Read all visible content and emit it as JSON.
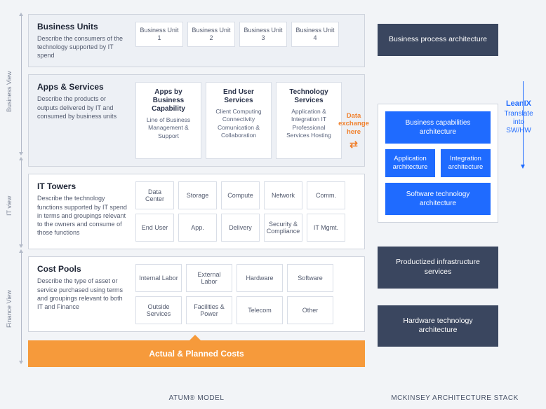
{
  "sideLabels": {
    "business": "Business View",
    "it": "IT view",
    "finance": "Finance View"
  },
  "sections": {
    "bu": {
      "title": "Business Units",
      "desc": "Describe the consumers of the technology supported by IT spend",
      "items": [
        "Business Unit 1",
        "Business Unit 2",
        "Business Unit 3",
        "Business Unit 4"
      ]
    },
    "apps": {
      "title": "Apps & Services",
      "desc": "Describe the products or outputs delivered by IT and consumed by business units",
      "items": [
        {
          "title": "Apps by Business Capability",
          "sub": "Line of Business Management & Support"
        },
        {
          "title": "End User Services",
          "sub": "Client Computing Connectivity Comunication & Collaboration"
        },
        {
          "title": "Technology Services",
          "sub": "Application & Integration IT Professional Services Hosting"
        }
      ]
    },
    "towers": {
      "title": "IT Towers",
      "desc": "Describe the technology functions supported by IT spend in terms and groupings relevant to the owners and consume of those functions",
      "items": [
        "Data Center",
        "Storage",
        "Compute",
        "Network",
        "Comm.",
        "End User",
        "App.",
        "Delivery",
        "Security & Compliance",
        "IT Mgmt."
      ]
    },
    "cost": {
      "title": "Cost Pools",
      "desc": "Describe the type of asset or service purchased using terms and groupings relevant to both IT and Finance",
      "items": [
        "Internal Labor",
        "External Labor",
        "Hardware",
        "Software",
        "Outside Services",
        "Facilities & Power",
        "Telecom",
        "Other"
      ]
    }
  },
  "orangeBar": "Actual & Planned Costs",
  "footers": {
    "left": "ATUM® MODEL",
    "right": "MCKINSEY ARCHITECTURE STACK"
  },
  "exchange": "Data exchange here",
  "leanix": {
    "brand": "LeanIX",
    "text": "Translate into SW/HW"
  },
  "stack": {
    "top": "Business process architecture",
    "blue": {
      "cap": "Business capabilities architecture",
      "app": "Application architecture",
      "int": "Integration architecture",
      "sw": "Software technology architecture"
    },
    "infra": "Productized infrastructure services",
    "hw": "Hardware technology architecture"
  }
}
